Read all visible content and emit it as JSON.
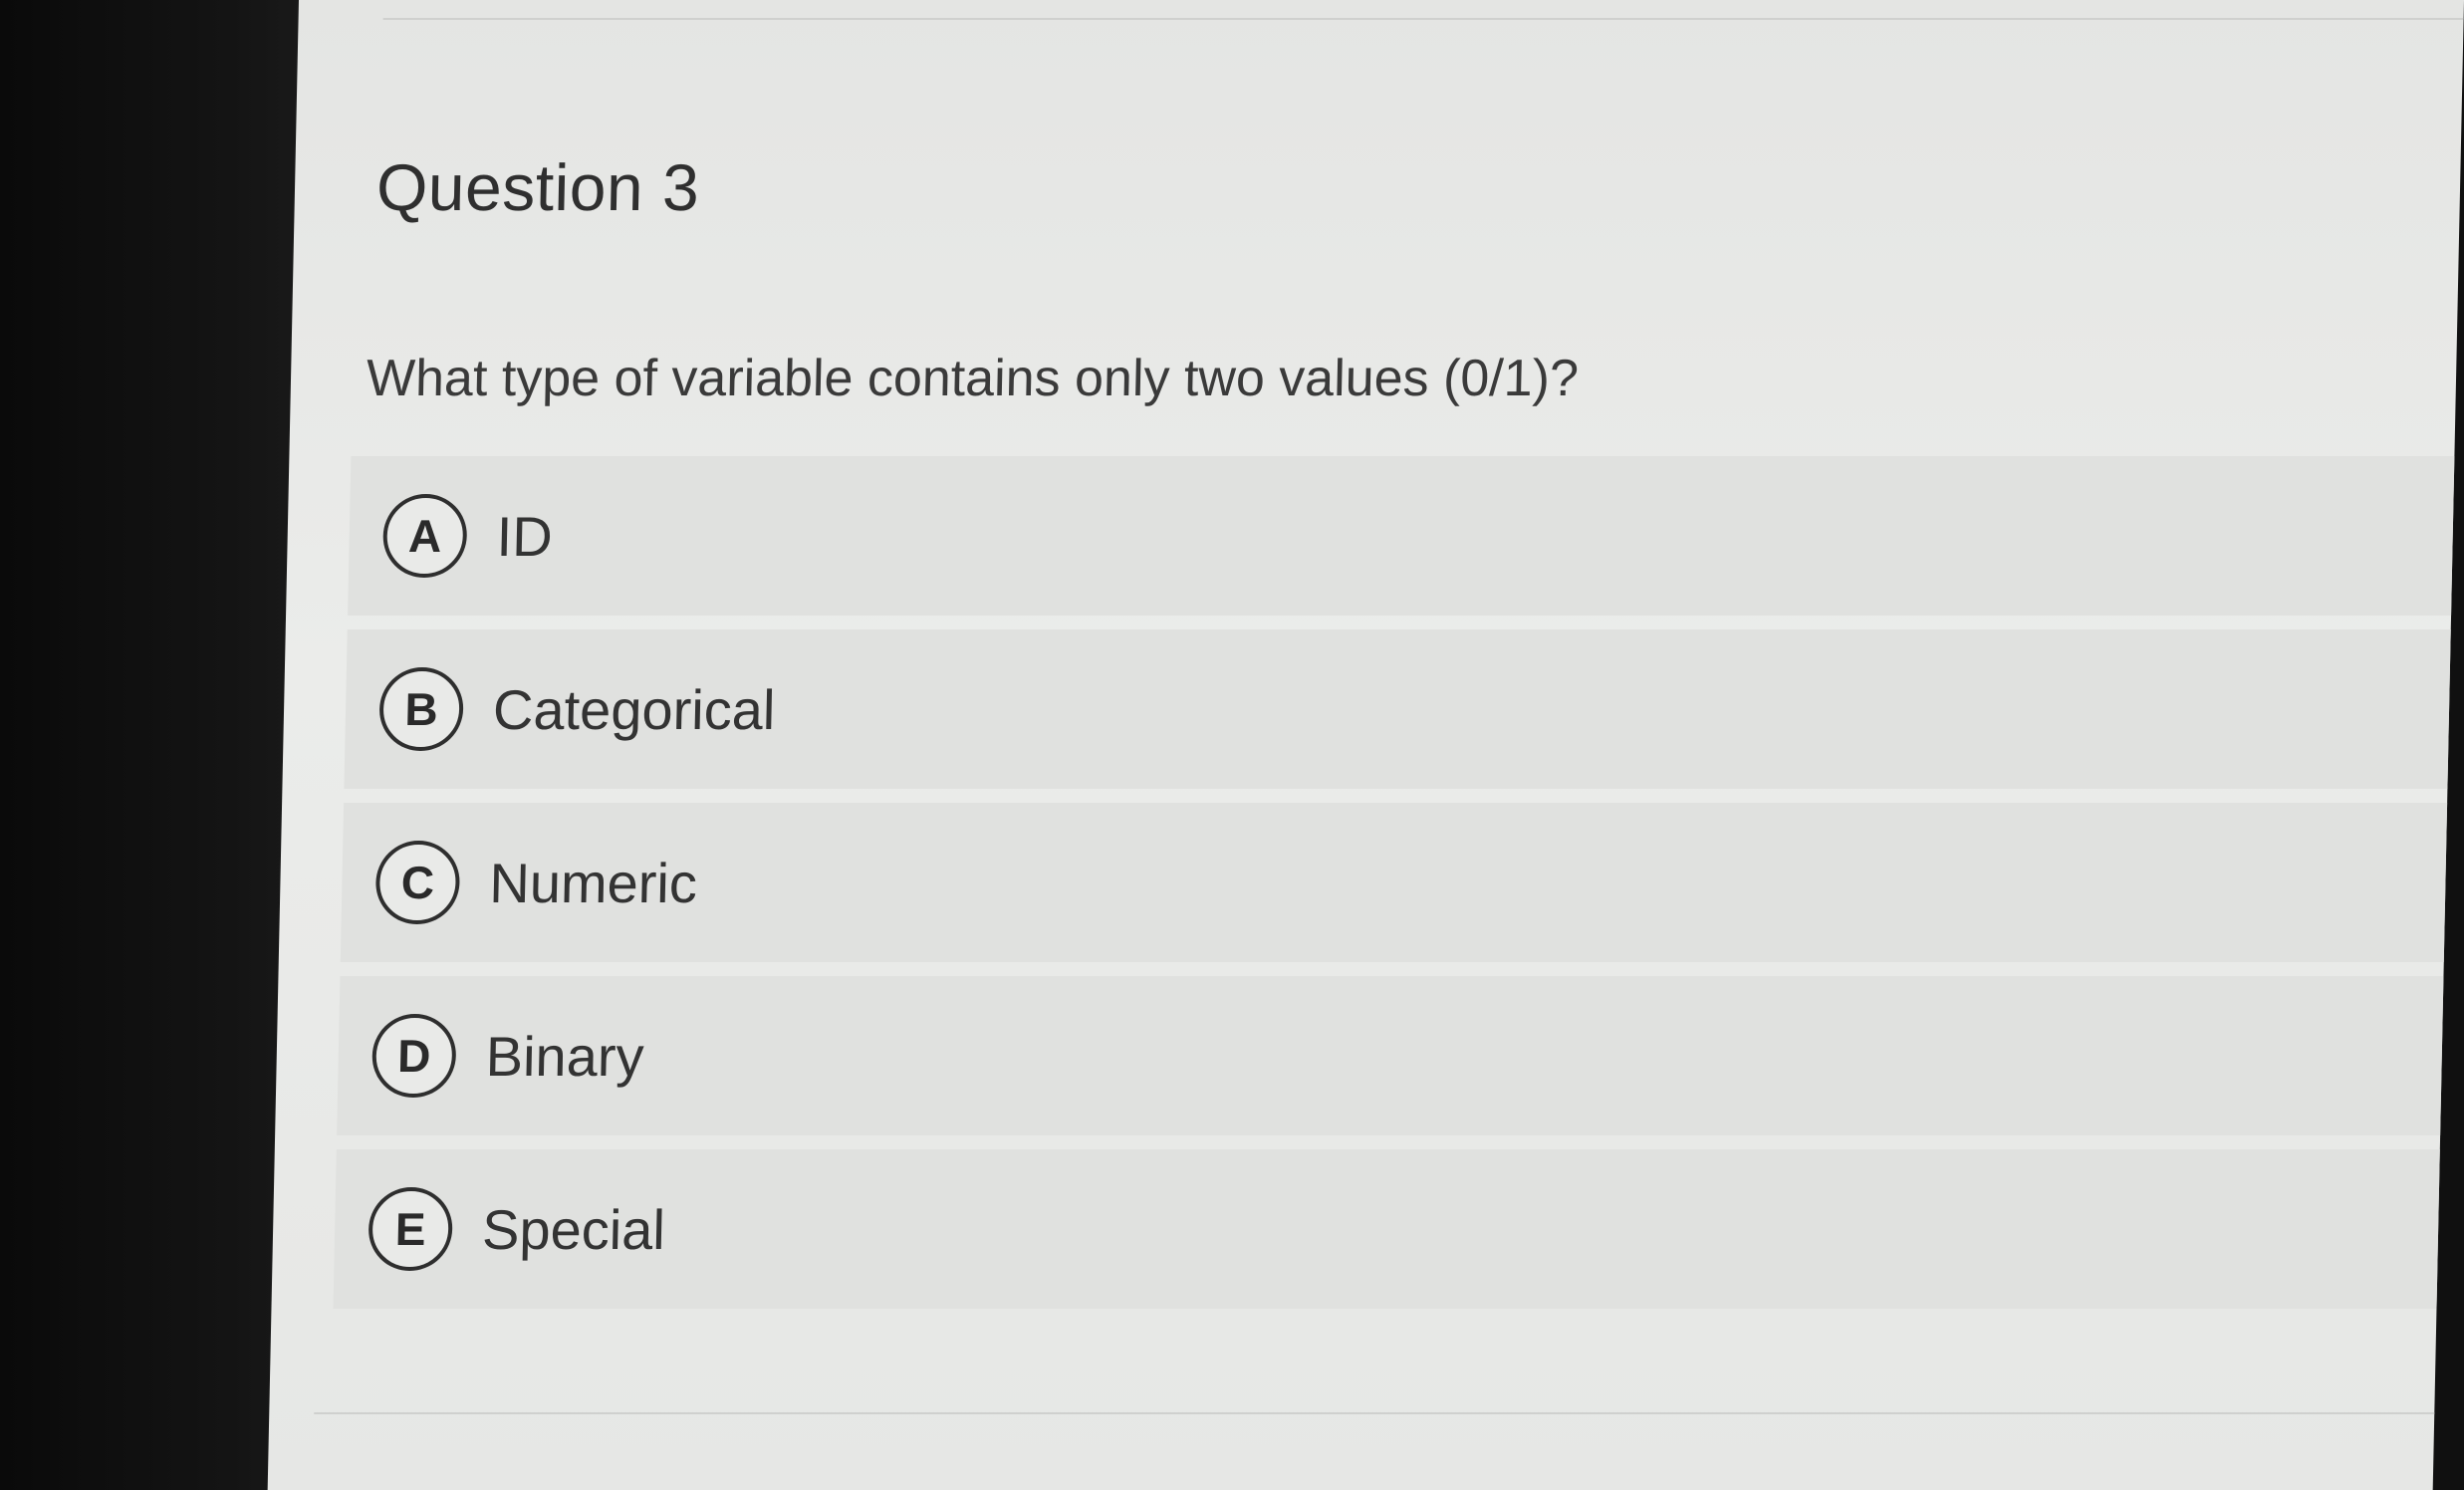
{
  "question": {
    "title": "Question 3",
    "text": "What type of variable contains only two values (0/1)?"
  },
  "options": [
    {
      "letter": "A",
      "label": "ID"
    },
    {
      "letter": "B",
      "label": "Categorical"
    },
    {
      "letter": "C",
      "label": "Numeric"
    },
    {
      "letter": "D",
      "label": "Binary"
    },
    {
      "letter": "E",
      "label": "Special"
    }
  ]
}
